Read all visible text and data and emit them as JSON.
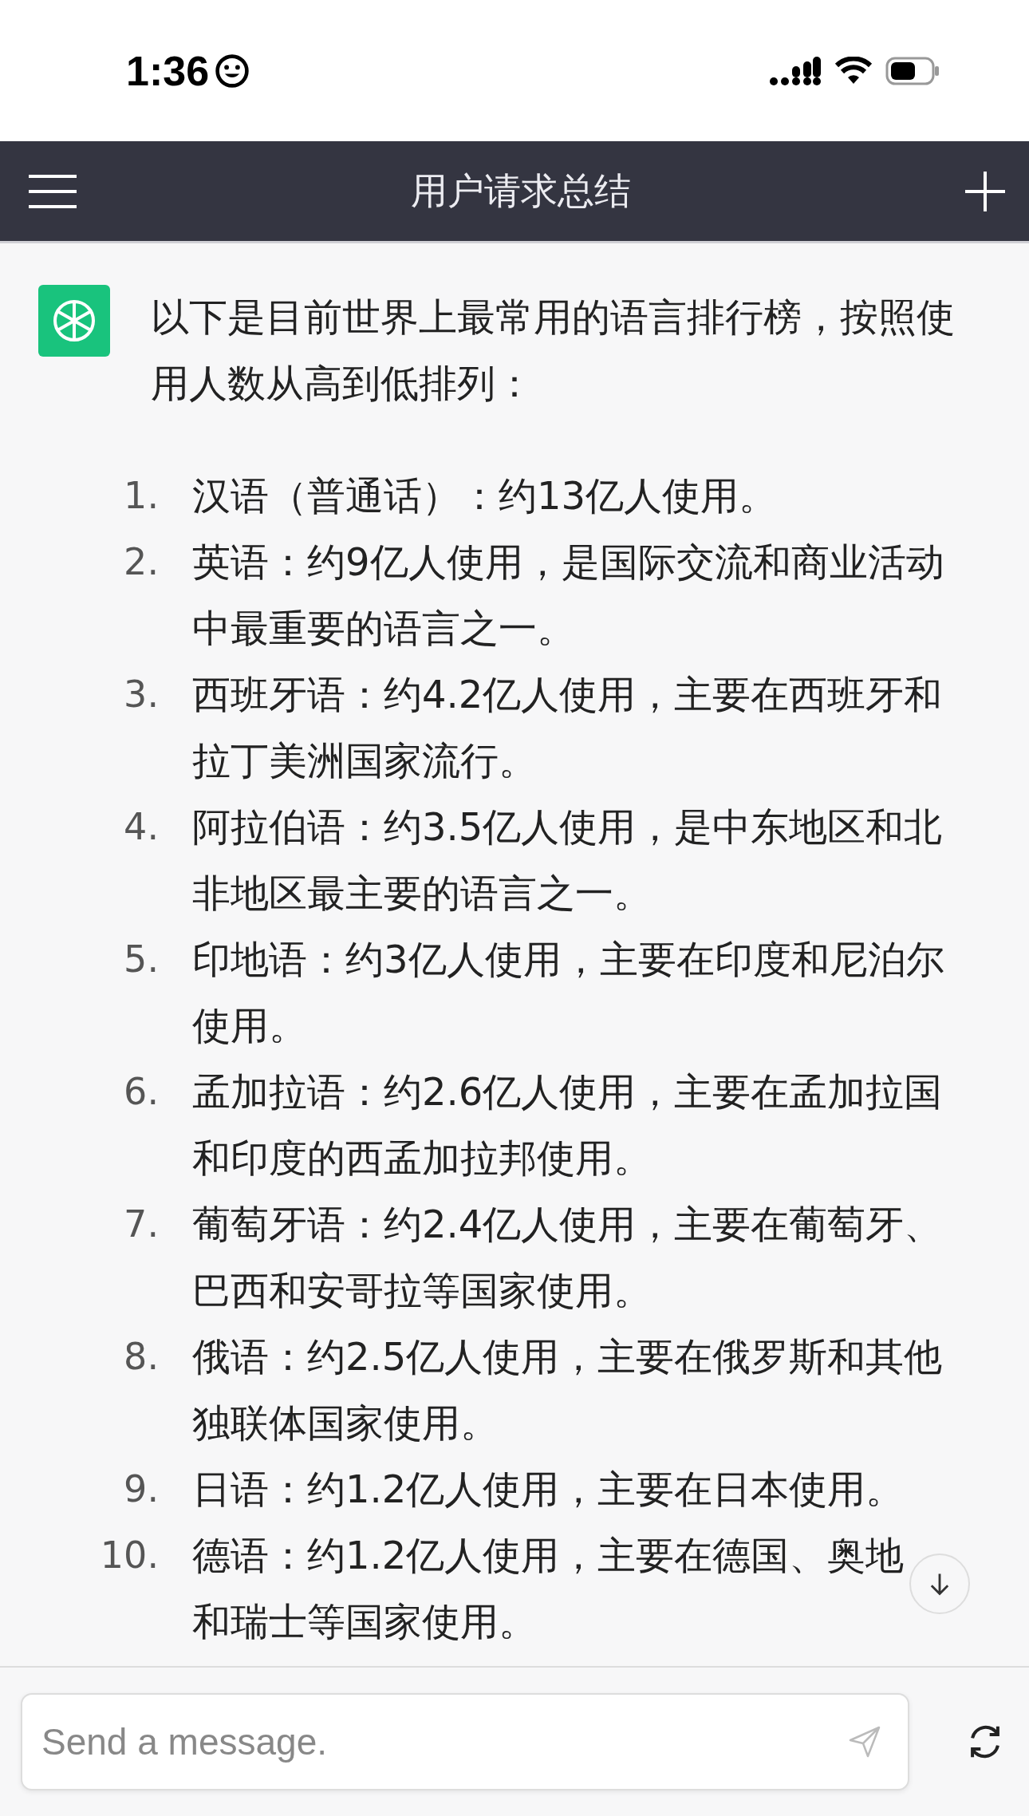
{
  "status_bar": {
    "time": "1:36"
  },
  "header": {
    "title": "用户请求总结"
  },
  "message": {
    "intro": [
      "以下是目前世界上最常用的语言排行榜，按照使",
      "用人数从高到低排列："
    ],
    "items": [
      {
        "number": "1.",
        "lines": [
          "汉语（普通话）：约13亿人使用。"
        ]
      },
      {
        "number": "2.",
        "lines": [
          "英语：约9亿人使用，是国际交流和商业活动",
          "中最重要的语言之一。"
        ]
      },
      {
        "number": "3.",
        "lines": [
          "西班牙语：约4.2亿人使用，主要在西班牙和",
          "拉丁美洲国家流行。"
        ]
      },
      {
        "number": "4.",
        "lines": [
          "阿拉伯语：约3.5亿人使用，是中东地区和北",
          "非地区最主要的语言之一。"
        ]
      },
      {
        "number": "5.",
        "lines": [
          "印地语：约3亿人使用，主要在印度和尼泊尔",
          "使用。"
        ]
      },
      {
        "number": "6.",
        "lines": [
          "孟加拉语：约2.6亿人使用，主要在孟加拉国",
          "和印度的西孟加拉邦使用。"
        ]
      },
      {
        "number": "7.",
        "lines": [
          "葡萄牙语：约2.4亿人使用，主要在葡萄牙、",
          "巴西和安哥拉等国家使用。"
        ]
      },
      {
        "number": "8.",
        "lines": [
          "俄语：约2.5亿人使用，主要在俄罗斯和其他",
          "独联体国家使用。"
        ]
      },
      {
        "number": "9.",
        "lines": [
          "日语：约1.2亿人使用，主要在日本使用。"
        ]
      },
      {
        "number": "10.",
        "lines": [
          "德语：约1.2亿人使用，主要在德国、奥地",
          "和瑞士等国家使用。"
        ]
      }
    ]
  },
  "composer": {
    "placeholder": "Send a message."
  }
}
